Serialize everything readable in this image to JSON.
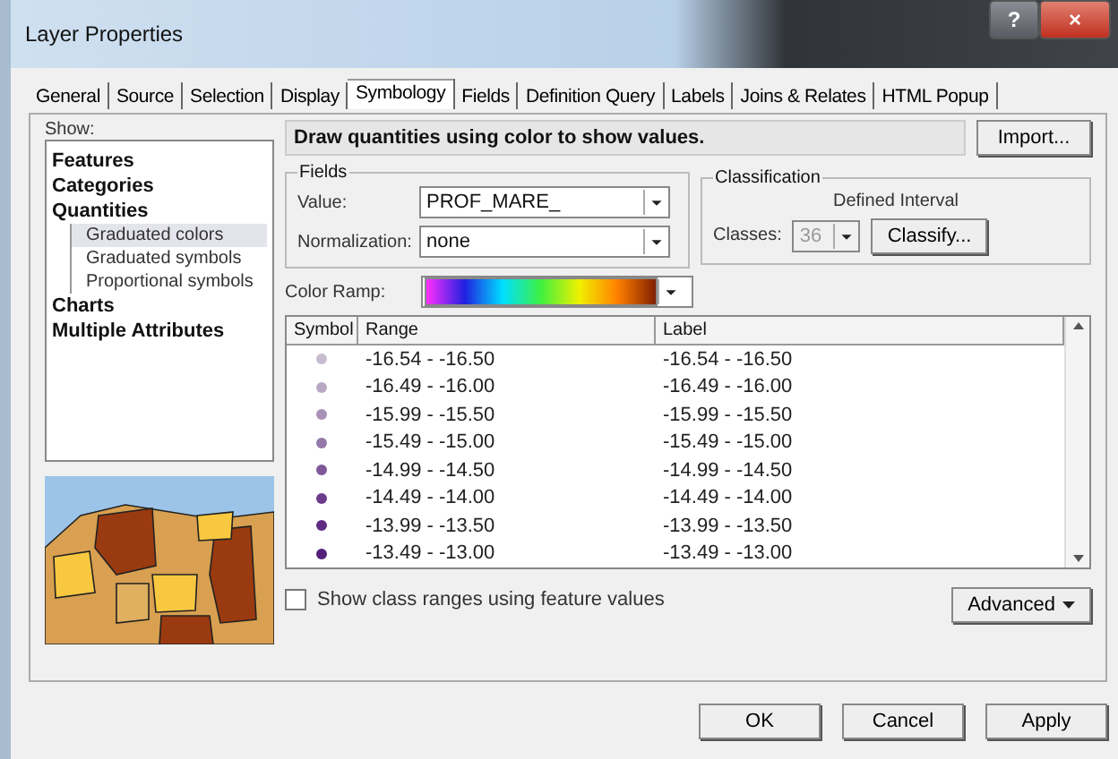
{
  "window": {
    "title": "Layer Properties",
    "controls": [
      "?",
      "×"
    ]
  },
  "tabs": [
    {
      "label": "General",
      "selected": false
    },
    {
      "label": "Source",
      "selected": false
    },
    {
      "label": "Selection",
      "selected": false
    },
    {
      "label": "Display",
      "selected": false
    },
    {
      "label": "Symbology",
      "selected": true
    },
    {
      "label": "Fields",
      "selected": false
    },
    {
      "label": "Definition Query",
      "selected": false
    },
    {
      "label": "Labels",
      "selected": false
    },
    {
      "label": "Joins & Relates",
      "selected": false
    },
    {
      "label": "HTML Popup",
      "selected": false
    }
  ],
  "show": {
    "label": "Show:",
    "items": [
      {
        "label": "Features",
        "selected": false
      },
      {
        "label": "Categories",
        "selected": false
      },
      {
        "label": "Quantities",
        "selected": false,
        "children": [
          {
            "label": "Graduated colors",
            "selected": true
          },
          {
            "label": "Graduated symbols",
            "selected": false
          },
          {
            "label": "Proportional symbols",
            "selected": false
          }
        ]
      },
      {
        "label": "Charts",
        "selected": false
      },
      {
        "label": "Multiple Attributes",
        "selected": false
      }
    ]
  },
  "description": "Draw quantities using color to show values.",
  "import_button": "Import...",
  "fields": {
    "title": "Fields",
    "value_label": "Value:",
    "value": "PROF_MARE_",
    "normalization_label": "Normalization:",
    "normalization": "none"
  },
  "classification": {
    "title": "Classification",
    "method": "Defined Interval",
    "classes_label": "Classes:",
    "classes": "36",
    "classes_disabled": true,
    "classify_button": "Classify..."
  },
  "color_ramp": {
    "label": "Color Ramp:"
  },
  "table": {
    "columns": [
      "Symbol",
      "Range",
      "Label"
    ],
    "rows": [
      {
        "color": "#c8bcd0",
        "range": "-16.54 - -16.50",
        "label": "-16.54 - -16.50"
      },
      {
        "color": "#b8a8c4",
        "range": "-16.49 - -16.00",
        "label": "-16.49 - -16.00"
      },
      {
        "color": "#a892b8",
        "range": "-15.99 - -15.50",
        "label": "-15.99 - -15.50"
      },
      {
        "color": "#9478a8",
        "range": "-15.49 - -15.00",
        "label": "-15.49 - -15.00"
      },
      {
        "color": "#80589a",
        "range": "-14.99 - -14.50",
        "label": "-14.99 - -14.50"
      },
      {
        "color": "#6c3c8c",
        "range": "-14.49 - -14.00",
        "label": "-14.49 - -14.00"
      },
      {
        "color": "#602c84",
        "range": "-13.99 - -13.50",
        "label": "-13.99 - -13.50"
      },
      {
        "color": "#54207a",
        "range": "-13.49 - -13.00",
        "label": "-13.49 - -13.00"
      }
    ]
  },
  "show_class_ranges": {
    "label": "Show class ranges using feature values",
    "checked": false
  },
  "advanced_button": "Advanced",
  "buttons": [
    "OK",
    "Cancel",
    "Apply"
  ]
}
